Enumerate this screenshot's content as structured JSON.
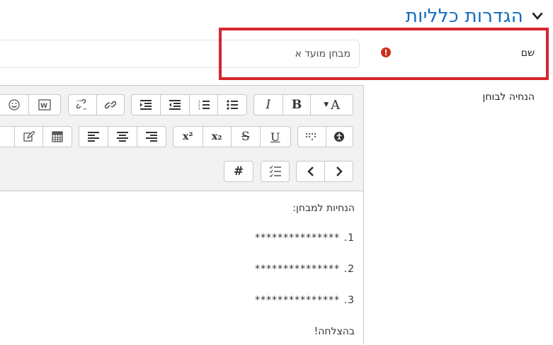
{
  "section": {
    "title": "הגדרות כלליות"
  },
  "name_field": {
    "label": "שם",
    "value": "מבחן מועד א",
    "error_icon": "exclamation-circle-icon"
  },
  "instructions_field": {
    "label": "הנחיה לבוחן"
  },
  "editor": {
    "toolbar": {
      "row1": [
        "font-color",
        "bold",
        "italic",
        "unordered-list",
        "ordered-list",
        "outdent",
        "indent",
        "link",
        "unlink",
        "word-paste",
        "emoticon"
      ],
      "row2": [
        "accessibility-checker",
        "screenreader-helper",
        "underline",
        "strikethrough",
        "subscript",
        "superscript",
        "align-left",
        "align-center",
        "align-right",
        "table",
        "edit-pen"
      ],
      "row3": [
        "next",
        "prev",
        "checklist",
        "hashtag"
      ],
      "labels": {
        "font_color": "A",
        "bold": "B",
        "italic": "I",
        "underline": "U",
        "strike": "S",
        "sub": "x₂",
        "sup": "x²",
        "hash": "#"
      }
    },
    "content": {
      "heading": "הנחיות למבחן:",
      "items": [
        "1. ***************",
        "2. ***************",
        "3. ***************"
      ],
      "closing": "בהצלחה!"
    }
  },
  "colors": {
    "title": "#0f6cbf",
    "error": "#ca3120",
    "highlight": "#d6252d"
  }
}
